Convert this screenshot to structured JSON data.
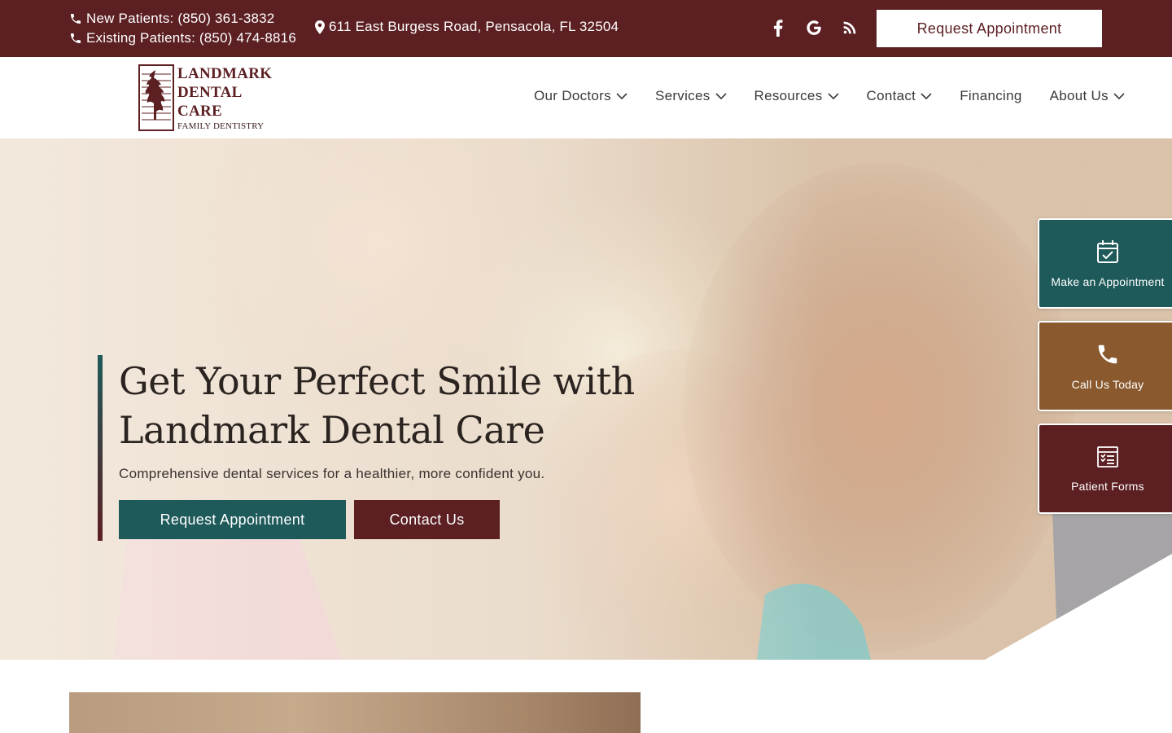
{
  "topbar": {
    "new_patients": "New Patients: (850) 361-3832",
    "existing_patients": "Existing Patients: (850) 474-8816",
    "address": "611 East Burgess Road, Pensacola, FL 32504",
    "socials": [
      "facebook-icon",
      "google-icon",
      "blog-icon"
    ],
    "cta_label": "Request Appointment"
  },
  "logo": {
    "line1": "LANDMARK",
    "line2": "DENTAL",
    "line3": "CARE",
    "tagline": "FAMILY DENTISTRY"
  },
  "nav": {
    "items": [
      {
        "label": "Our Doctors",
        "has_dropdown": true
      },
      {
        "label": "Services",
        "has_dropdown": true
      },
      {
        "label": "Resources",
        "has_dropdown": true
      },
      {
        "label": "Contact",
        "has_dropdown": true
      },
      {
        "label": "Financing",
        "has_dropdown": false
      },
      {
        "label": "About Us",
        "has_dropdown": true
      }
    ]
  },
  "hero": {
    "title_line1": "Get Your Perfect Smile with",
    "title_line2": "Landmark Dental Care",
    "subtitle": "Comprehensive dental services for a healthier, more confident you.",
    "primary_button": "Request Appointment",
    "secondary_button": "Contact Us"
  },
  "side_tabs": [
    {
      "label": "Make an Appointment",
      "icon": "calendar-check-icon"
    },
    {
      "label": "Call Us Today",
      "icon": "phone-icon"
    },
    {
      "label": "Patient Forms",
      "icon": "forms-icon"
    }
  ],
  "colors": {
    "maroon": "#5c1f22",
    "teal": "#1f5a5a",
    "brown": "#8a5a2e",
    "white": "#ffffff"
  }
}
